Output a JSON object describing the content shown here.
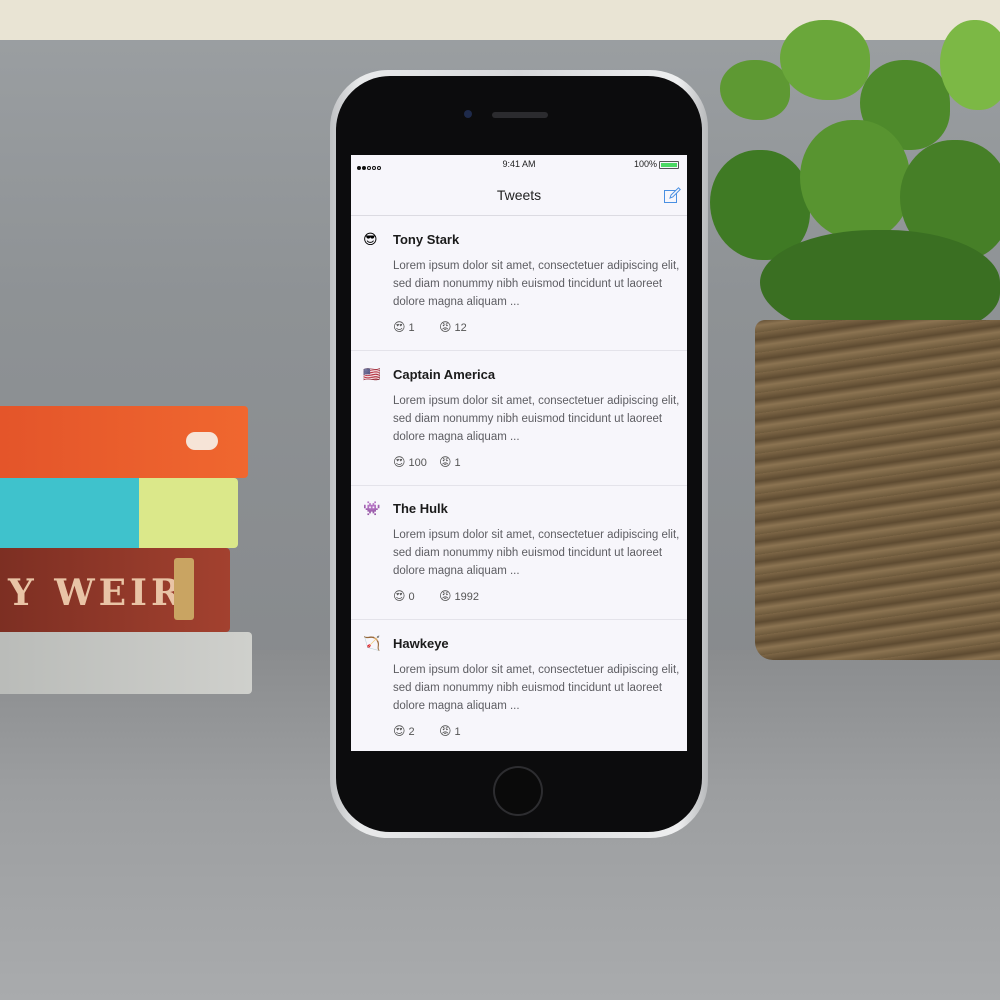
{
  "status_bar": {
    "time": "9:41 AM",
    "battery": "100%"
  },
  "nav": {
    "title": "Tweets",
    "compose_icon": "compose-icon"
  },
  "reaction_icons": {
    "love": "😍",
    "angry": "😡"
  },
  "tweets": [
    {
      "avatar": "😎",
      "name": "Tony Stark",
      "text": "Lorem ipsum dolor sit amet, consectetuer adipiscing elit, sed diam nonummy nibh euismod tincidunt ut laoreet dolore magna aliquam ...",
      "love_count": "1",
      "angry_count": "12"
    },
    {
      "avatar": "🇺🇸",
      "name": "Captain America",
      "text": "Lorem ipsum dolor sit amet, consectetuer adipiscing elit, sed diam nonummy nibh euismod tincidunt ut laoreet dolore magna aliquam ...",
      "love_count": "100",
      "angry_count": "1"
    },
    {
      "avatar": "👾",
      "name": "The Hulk",
      "text": "Lorem ipsum dolor sit amet, consectetuer adipiscing elit, sed diam nonummy nibh euismod tincidunt ut laoreet dolore magna aliquam ...",
      "love_count": "0",
      "angry_count": "1992"
    },
    {
      "avatar": "🏹",
      "name": "Hawkeye",
      "text": "Lorem ipsum dolor sit amet, consectetuer adipiscing elit, sed diam nonummy nibh euismod tincidunt ut laoreet dolore magna aliquam ...",
      "love_count": "2",
      "angry_count": "1"
    }
  ]
}
